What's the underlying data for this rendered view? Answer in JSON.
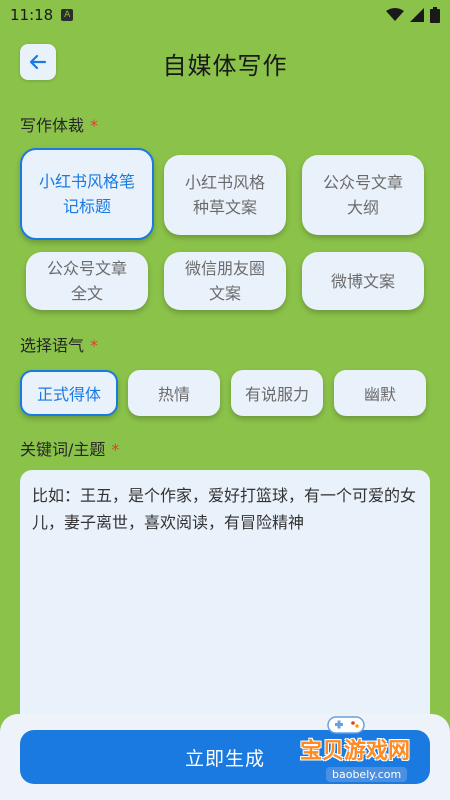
{
  "status": {
    "time": "11:18",
    "notif_badge": "A"
  },
  "header": {
    "title": "自媒体写作"
  },
  "genre": {
    "label": "写作体裁",
    "required": "*",
    "options": [
      "小红书风格笔记标题",
      "小红书风格种草文案",
      "公众号文章大纲",
      "公众号文章全文",
      "微信朋友圈文案",
      "微博文案"
    ],
    "selected_index": 0
  },
  "tone": {
    "label": "选择语气",
    "required": "*",
    "options": [
      "正式得体",
      "热情",
      "有说服力",
      "幽默"
    ],
    "selected_index": 0
  },
  "keywords": {
    "label": "关键词/主题",
    "required": "*",
    "placeholder": "比如：王五，是个作家，爱好打篮球，有一个可爱的女儿，妻子离世，喜欢阅读，有冒险精神"
  },
  "action": {
    "generate_label": "立即生成"
  },
  "watermark": {
    "text": "宝贝游戏网",
    "url": "baobely.com"
  },
  "colors": {
    "background": "#8bc34a",
    "accent": "#1a7ae0",
    "card": "#e9f1fb",
    "required": "#e53935"
  }
}
